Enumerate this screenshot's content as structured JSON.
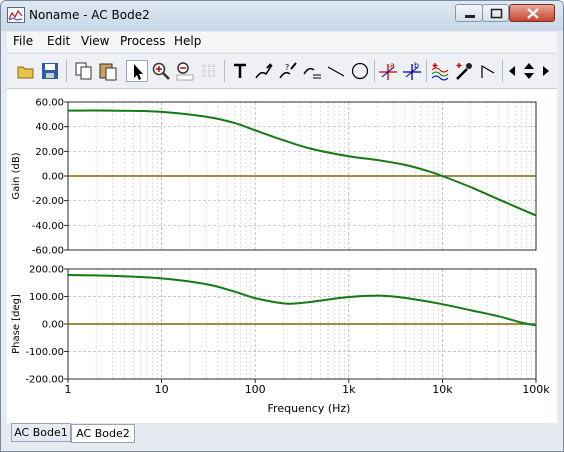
{
  "window": {
    "title": "Noname - AC Bode2"
  },
  "menu": [
    "File",
    "Edit",
    "View",
    "Process",
    "Help"
  ],
  "toolbar_icons": [
    "open-icon",
    "save-icon",
    "copy-icon",
    "paste-icon",
    "pointer-icon",
    "zoom-in-icon",
    "zoom-out-icon",
    "zoom-100-icon",
    "grid-icon",
    "text-icon",
    "pen-label-icon",
    "pen-question-icon",
    "pen-text-icon",
    "line-icon",
    "ellipse-icon",
    "cursor-a-icon",
    "cursor-b-icon",
    "curves-icon",
    "color-picker-icon",
    "corner-icon",
    "arrow-left-icon",
    "arrow-updown-icon",
    "arrow-right-icon"
  ],
  "tabs": [
    "AC Bode1",
    "AC Bode2"
  ],
  "active_tab": "AC Bode2",
  "colors": {
    "trace": "#157a15",
    "zero_line": "#7a6a00",
    "grid": "#c8c8c8"
  },
  "chart_data": [
    {
      "type": "line",
      "ylabel": "Gain (dB)",
      "xscale": "log",
      "xlim": [
        1,
        100000
      ],
      "ylim": [
        -60,
        60
      ],
      "yticks": [
        "60.00",
        "40.00",
        "20.00",
        "0.00",
        "-20.00",
        "-40.00",
        "-60.00"
      ],
      "x": [
        1,
        3,
        10,
        30,
        60,
        100,
        200,
        400,
        1000,
        2000,
        4000,
        7000,
        10000,
        20000,
        40000,
        70000,
        100000
      ],
      "values": [
        53,
        53,
        52,
        48,
        43,
        37,
        29,
        22,
        16,
        13,
        9,
        4,
        0,
        -9,
        -19,
        -27,
        -32
      ],
      "zero_line": 0
    },
    {
      "type": "line",
      "ylabel": "Phase [deg]",
      "xlabel": "Frequency (Hz)",
      "xscale": "log",
      "xlim": [
        1,
        100000
      ],
      "ylim": [
        -200,
        200
      ],
      "yticks": [
        "200.00",
        "100.00",
        "0.00",
        "-100.00",
        "-200.00"
      ],
      "xticks": [
        "1",
        "10",
        "100",
        "1k",
        "10k",
        "100k"
      ],
      "x": [
        1,
        3,
        10,
        30,
        60,
        100,
        200,
        300,
        500,
        1000,
        2000,
        3000,
        5000,
        10000,
        20000,
        40000,
        70000,
        100000
      ],
      "values": [
        178,
        175,
        166,
        145,
        118,
        94,
        75,
        76,
        85,
        98,
        103,
        100,
        90,
        72,
        50,
        28,
        5,
        -5
      ],
      "zero_line": 0
    }
  ]
}
